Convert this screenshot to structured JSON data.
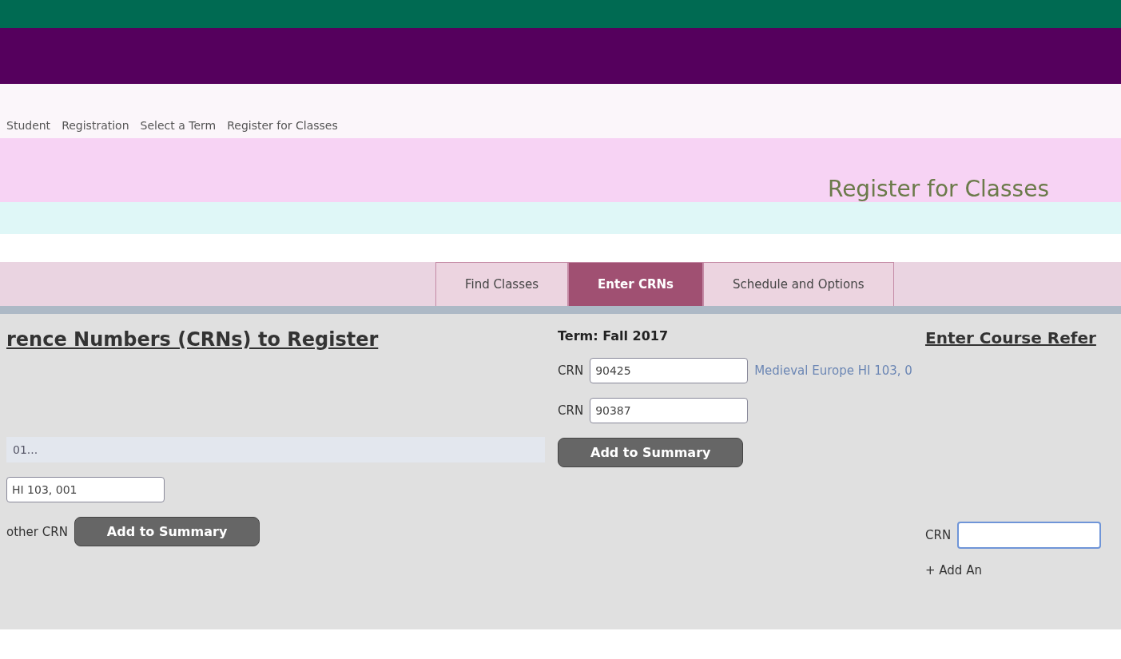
{
  "breadcrumb": [
    "Student",
    "Registration",
    "Select a Term",
    "Register for Classes"
  ],
  "page_title": "Register for Classes",
  "tabs": [
    {
      "label": "Find Classes",
      "selected": false
    },
    {
      "label": "Enter CRNs",
      "selected": true
    },
    {
      "label": "Schedule and Options",
      "selected": false
    }
  ],
  "left_panel": {
    "heading": "rence Numbers (CRNs) to Register",
    "summary_row": "01...",
    "crn_value": "HI 103, 001",
    "link": "other CRN",
    "button": "Add to Summary"
  },
  "middle_panel": {
    "term": "Term: Fall 2017",
    "crn_rows": [
      {
        "label": "CRN",
        "value": "90425",
        "course": "Medieval Europe HI 103, 0"
      },
      {
        "label": "CRN",
        "value": "90387",
        "course": ""
      }
    ],
    "button": "Add to Summary"
  },
  "right_panel": {
    "heading": "Enter Course Refer",
    "crn_label": "CRN",
    "add_link": "+ Add An"
  }
}
